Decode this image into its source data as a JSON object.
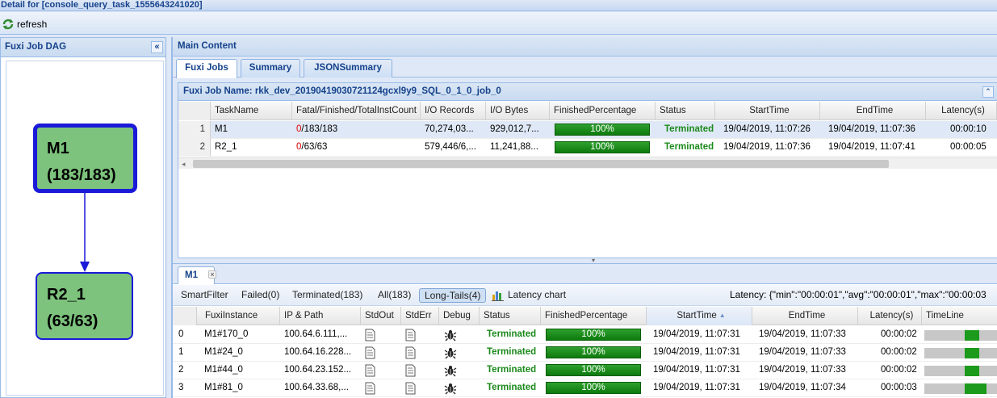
{
  "window": {
    "title": "Detail for [console_query_task_1555643241020]"
  },
  "toolbar": {
    "refresh_label": "refresh"
  },
  "dag": {
    "title": "Fuxi Job DAG",
    "collapse_glyph": "«",
    "nodes": [
      {
        "name": "M1",
        "count": "(183/183)"
      },
      {
        "name": "R2_1",
        "count": "(63/63)"
      }
    ]
  },
  "main": {
    "title": "Main Content",
    "tabs": [
      "Fuxi Jobs",
      "Summary",
      "JSONSummary"
    ],
    "active_tab": "Fuxi Jobs"
  },
  "job": {
    "title": "Fuxi Job Name: rkk_dev_20190419030721124gcxl9y9_SQL_0_1_0_job_0",
    "collapse_glyph": "⌃",
    "columns": [
      "TaskName",
      "Fatal/Finished/TotalInstCount",
      "I/O Records",
      "I/O Bytes",
      "FinishedPercentage",
      "Status",
      "StartTime",
      "EndTime",
      "Latency(s)"
    ],
    "rows": [
      {
        "num": "1",
        "task": "M1",
        "fatal": "0",
        "finished_total": "/183/183",
        "records": "70,274,03...",
        "bytes": "929,012,7...",
        "pct": "100%",
        "pct_value": 100,
        "status": "Terminated",
        "start": "19/04/2019, 11:07:26",
        "end": "19/04/2019, 11:07:36",
        "latency": "00:00:10"
      },
      {
        "num": "2",
        "task": "R2_1",
        "fatal": "0",
        "finished_total": "/63/63",
        "records": "579,446/6,...",
        "bytes": "11,241,88...",
        "pct": "100%",
        "pct_value": 100,
        "status": "Terminated",
        "start": "19/04/2019, 11:07:36",
        "end": "19/04/2019, 11:07:41",
        "latency": "00:00:05"
      }
    ],
    "scroll_left_glyph": "◂"
  },
  "instances": {
    "tab_label": "M1",
    "tab_close": "×",
    "filters": [
      {
        "label": "SmartFilter"
      },
      {
        "label": "Failed(0)"
      },
      {
        "label": "Terminated(183)"
      },
      {
        "label": "All(183)"
      },
      {
        "label": "Long-Tails(4)"
      }
    ],
    "latency_chart_label": "Latency chart",
    "latency_summary": "Latency: {\"min\":\"00:00:01\",\"avg\":\"00:00:01\",\"max\":\"00:00:03",
    "columns": [
      "FuxiInstance",
      "IP & Path",
      "StdOut",
      "StdErr",
      "Debug",
      "Status",
      "FinishedPercentage",
      "StartTime",
      "EndTime",
      "Latency(s)",
      "TimeLine"
    ],
    "rows": [
      {
        "idx": "0",
        "instance": "M1#170_0",
        "ip": "100.64.6.111,...",
        "status": "Terminated",
        "pct": "100%",
        "pct_value": 100,
        "start": "19/04/2019, 11:07:31",
        "end": "19/04/2019, 11:07:33",
        "latency": "00:00:02",
        "timeline_start": 0.55,
        "timeline_len": 0.2
      },
      {
        "idx": "1",
        "instance": "M1#24_0",
        "ip": "100.64.16.228...",
        "status": "Terminated",
        "pct": "100%",
        "pct_value": 100,
        "start": "19/04/2019, 11:07:31",
        "end": "19/04/2019, 11:07:33",
        "latency": "00:00:02",
        "timeline_start": 0.55,
        "timeline_len": 0.2
      },
      {
        "idx": "2",
        "instance": "M1#44_0",
        "ip": "100.64.23.152...",
        "status": "Terminated",
        "pct": "100%",
        "pct_value": 100,
        "start": "19/04/2019, 11:07:31",
        "end": "19/04/2019, 11:07:33",
        "latency": "00:00:02",
        "timeline_start": 0.55,
        "timeline_len": 0.2
      },
      {
        "idx": "3",
        "instance": "M1#81_0",
        "ip": "100.64.33.68,...",
        "status": "Terminated",
        "pct": "100%",
        "pct_value": 100,
        "start": "19/04/2019, 11:07:31",
        "end": "19/04/2019, 11:07:34",
        "latency": "00:00:03",
        "timeline_start": 0.55,
        "timeline_len": 0.3
      }
    ]
  },
  "colors": {
    "header_text": "#15428b",
    "node_fill": "#7dc37d",
    "node_border": "#1a1ad8",
    "terminated": "#1b8a1b",
    "progress": "#1b8a1b",
    "fatal": "#e00000"
  },
  "icons": [
    "refresh-icon",
    "collapse-left-icon",
    "collapse-up-icon",
    "latency-chart-icon",
    "stdout-icon",
    "stderr-icon",
    "debug-bug-icon",
    "close-icon",
    "sort-asc-icon"
  ]
}
